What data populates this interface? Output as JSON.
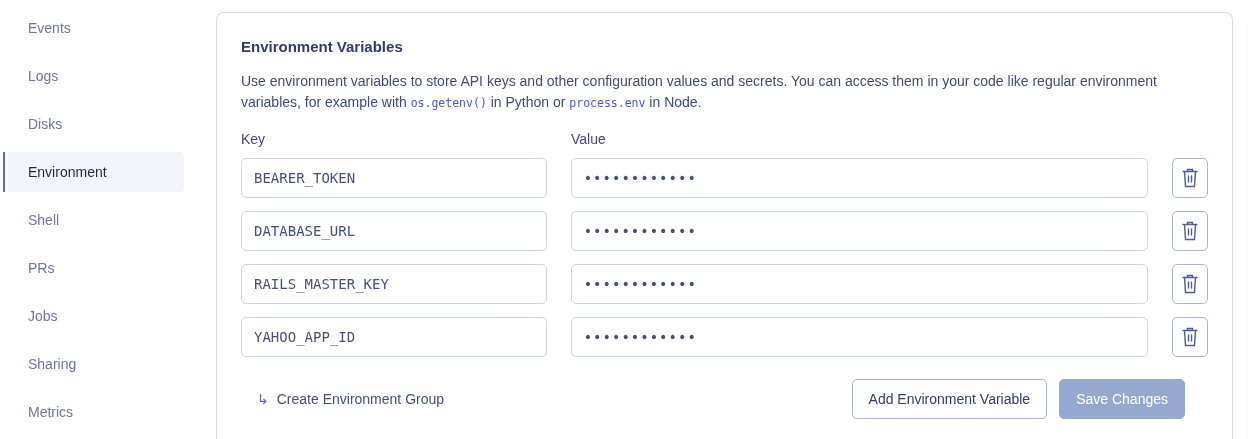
{
  "sidebar": {
    "items": [
      {
        "label": "Events",
        "selected": false
      },
      {
        "label": "Logs",
        "selected": false
      },
      {
        "label": "Disks",
        "selected": false
      },
      {
        "label": "Environment",
        "selected": true
      },
      {
        "label": "Shell",
        "selected": false
      },
      {
        "label": "PRs",
        "selected": false
      },
      {
        "label": "Jobs",
        "selected": false
      },
      {
        "label": "Sharing",
        "selected": false
      },
      {
        "label": "Metrics",
        "selected": false
      }
    ]
  },
  "panel": {
    "title": "Environment Variables",
    "description": [
      {
        "kind": "text",
        "text": "Use environment variables to store API keys and other configuration values and secrets. You can access them in your code like regular environment variables, for example with "
      },
      {
        "kind": "code",
        "text": "os.getenv()"
      },
      {
        "kind": "text",
        "text": " in Python or "
      },
      {
        "kind": "code",
        "text": "process.env"
      },
      {
        "kind": "text",
        "text": " in Node."
      }
    ],
    "key_label": "Key",
    "value_label": "Value",
    "variables": [
      {
        "key": "BEARER_TOKEN",
        "value": "••••••••••••"
      },
      {
        "key": "DATABASE_URL",
        "value": "••••••••••••"
      },
      {
        "key": "RAILS_MASTER_KEY",
        "value": "••••••••••••"
      },
      {
        "key": "YAHOO_APP_ID",
        "value": "••••••••••••"
      }
    ],
    "group_link": {
      "icon": "↳",
      "label": "Create Environment Group"
    },
    "add_button": {
      "label": "Add Environment Variable"
    },
    "save_button": {
      "label": "Save Changes",
      "disabled": true
    }
  }
}
